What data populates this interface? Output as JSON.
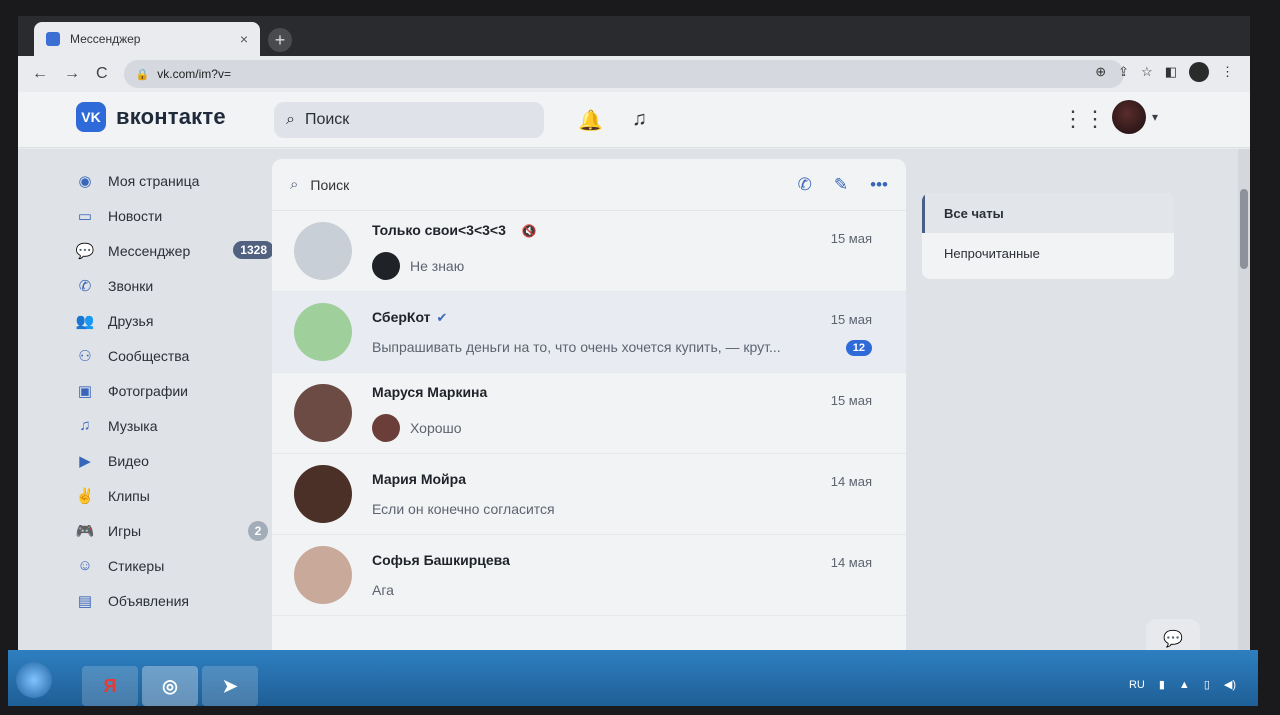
{
  "browser": {
    "tab_title": "Мессенджер",
    "tab_close": "×",
    "new_tab": "+",
    "url": "vk.com/im?v=",
    "nav": {
      "back": "←",
      "forward": "→",
      "reload": "C"
    }
  },
  "vk": {
    "logo_mark": "VK",
    "brand": "вконтакте",
    "search_placeholder": "Поиск"
  },
  "sidebar": {
    "items": [
      {
        "label": "Моя страница",
        "icon": "user-circle-icon",
        "glyph": "◉"
      },
      {
        "label": "Новости",
        "icon": "news-icon",
        "glyph": "▭"
      },
      {
        "label": "Мессенджер",
        "icon": "chat-bubble-icon",
        "glyph": "💬",
        "badge": "1328"
      },
      {
        "label": "Звонки",
        "icon": "phone-icon",
        "glyph": "✆"
      },
      {
        "label": "Друзья",
        "icon": "friends-icon",
        "glyph": "👥"
      },
      {
        "label": "Сообщества",
        "icon": "communities-icon",
        "glyph": "⚇"
      },
      {
        "label": "Фотографии",
        "icon": "photo-icon",
        "glyph": "▣"
      },
      {
        "label": "Музыка",
        "icon": "music-icon",
        "glyph": "♫"
      },
      {
        "label": "Видео",
        "icon": "video-icon",
        "glyph": "▶"
      },
      {
        "label": "Клипы",
        "icon": "clips-icon",
        "glyph": "✌"
      },
      {
        "label": "Игры",
        "icon": "games-icon",
        "glyph": "🎮",
        "badge": "2"
      },
      {
        "label": "Стикеры",
        "icon": "stickers-icon",
        "glyph": "☺"
      },
      {
        "label": "Объявления",
        "icon": "ads-icon",
        "glyph": "▤"
      }
    ]
  },
  "messenger": {
    "search_placeholder": "Поиск",
    "chats": [
      {
        "name": "Только свои<3<3<3",
        "date": "15 мая",
        "message": "Не знаю",
        "muted": true,
        "verified": false,
        "unread": "",
        "avatar": "#c9cfd6",
        "mini": "#1f2227"
      },
      {
        "name": "СберКот",
        "date": "15 мая",
        "message": "Выпрашивать деньги на то, что очень хочется купить, — крут...",
        "muted": false,
        "verified": true,
        "unread": "12",
        "avatar": "#9fcf9a",
        "mini": ""
      },
      {
        "name": "Маруся Маркина",
        "date": "15 мая",
        "message": "Хорошо",
        "muted": false,
        "verified": false,
        "unread": "",
        "avatar": "#6b4b43",
        "mini": "#6b3e3a"
      },
      {
        "name": "Мария Мойра",
        "date": "14 мая",
        "message": "Если он конечно согласится",
        "muted": false,
        "verified": false,
        "unread": "",
        "avatar": "#4a3026",
        "mini": ""
      },
      {
        "name": "Софья Башкирцева",
        "date": "14 мая",
        "message": "Ага",
        "muted": false,
        "verified": false,
        "unread": "",
        "avatar": "#c9a99a",
        "mini": ""
      }
    ]
  },
  "filters": {
    "all": "Все чаты",
    "unread": "Непрочитанные"
  },
  "taskbar": {
    "lang": "RU",
    "yandex": "Я"
  }
}
